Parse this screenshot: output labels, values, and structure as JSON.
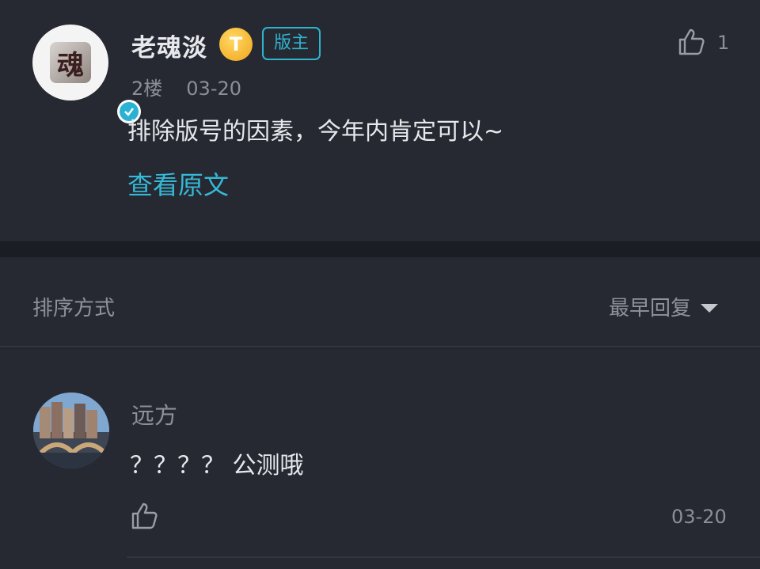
{
  "post": {
    "author": "老魂淡",
    "level_badge": "T",
    "role_badge": "版主",
    "floor": "2楼",
    "date": "03-20",
    "content": "排除版号的因素，今年内肯定可以~",
    "view_original": "查看原文",
    "like_count": "1",
    "avatar_glyph": "魂"
  },
  "sort": {
    "label": "排序方式",
    "selected": "最早回复"
  },
  "reply": {
    "author": "远方",
    "content": "？？？？ 公测哦",
    "date": "03-20"
  },
  "colors": {
    "accent": "#35b9d6",
    "level_gold": "#f0a51f",
    "background": "#262832"
  }
}
